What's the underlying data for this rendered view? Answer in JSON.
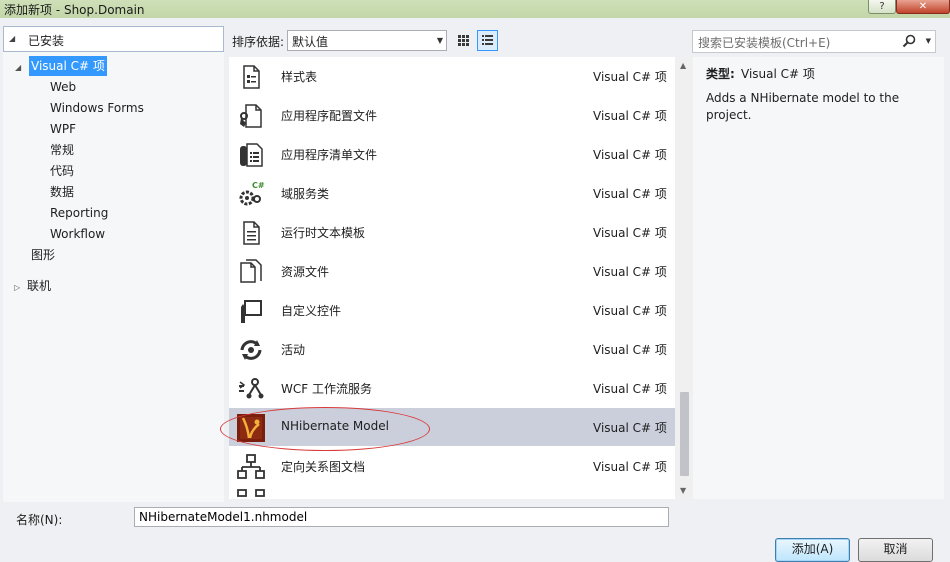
{
  "window": {
    "title": "添加新项 - Shop.Domain",
    "help": "?",
    "close": "✕"
  },
  "tree": {
    "header": "已安装",
    "items": [
      {
        "label": "Visual C# 项",
        "expanded": true,
        "selected": true
      },
      {
        "label": "Web"
      },
      {
        "label": "Windows Forms"
      },
      {
        "label": "WPF"
      },
      {
        "label": "常规"
      },
      {
        "label": "代码"
      },
      {
        "label": "数据"
      },
      {
        "label": "Reporting"
      },
      {
        "label": "Workflow"
      },
      {
        "label": "图形"
      },
      {
        "label": "联机",
        "expandable": true
      }
    ]
  },
  "toolbar": {
    "sort_label": "排序依据:",
    "sort_value": "默认值",
    "search_placeholder": "搜索已安装模板(Ctrl+E)"
  },
  "templates": [
    {
      "name": "样式表",
      "type": "Visual C# 项",
      "icon": "stylesheet-icon"
    },
    {
      "name": "应用程序配置文件",
      "type": "Visual C# 项",
      "icon": "app-config-icon"
    },
    {
      "name": "应用程序清单文件",
      "type": "Visual C# 项",
      "icon": "app-manifest-icon"
    },
    {
      "name": "域服务类",
      "type": "Visual C# 项",
      "icon": "domain-service-icon"
    },
    {
      "name": "运行时文本模板",
      "type": "Visual C# 项",
      "icon": "text-template-icon"
    },
    {
      "name": "资源文件",
      "type": "Visual C# 项",
      "icon": "resource-file-icon"
    },
    {
      "name": "自定义控件",
      "type": "Visual C# 项",
      "icon": "custom-control-icon"
    },
    {
      "name": "活动",
      "type": "Visual C# 项",
      "icon": "activity-icon"
    },
    {
      "name": "WCF 工作流服务",
      "type": "Visual C# 项",
      "icon": "wcf-workflow-icon"
    },
    {
      "name": "NHibernate Model",
      "type": "Visual C# 项",
      "icon": "nhibernate-icon",
      "selected": true
    },
    {
      "name": "定向关系图文档",
      "type": "Visual C# 项",
      "icon": "directed-graph-icon"
    }
  ],
  "details": {
    "type_label": "类型:",
    "type_value": "Visual C# 项",
    "description": "Adds a NHibernate model to the project."
  },
  "name_field": {
    "label": "名称(N):",
    "value": "NHibernateModel1.nhmodel"
  },
  "buttons": {
    "add": "添加(A)",
    "cancel": "取消"
  }
}
